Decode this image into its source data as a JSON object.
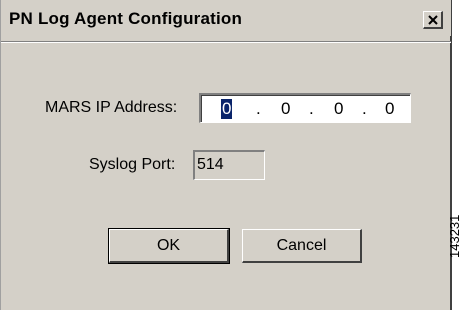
{
  "window": {
    "title": "PN Log Agent Configuration"
  },
  "form": {
    "ip_label": "MARS IP Address:",
    "ip_octets": [
      "0",
      "0",
      "0",
      "0"
    ],
    "ip_separator": ".",
    "port_label": "Syslog Port:",
    "port_value": "514"
  },
  "buttons": {
    "ok_label": "OK",
    "cancel_label": "Cancel"
  },
  "figure_id": "143231",
  "icons": {
    "close": "close-icon"
  },
  "colors": {
    "dialog_bg": "#d4d0c8",
    "selection": "#0a246a"
  }
}
